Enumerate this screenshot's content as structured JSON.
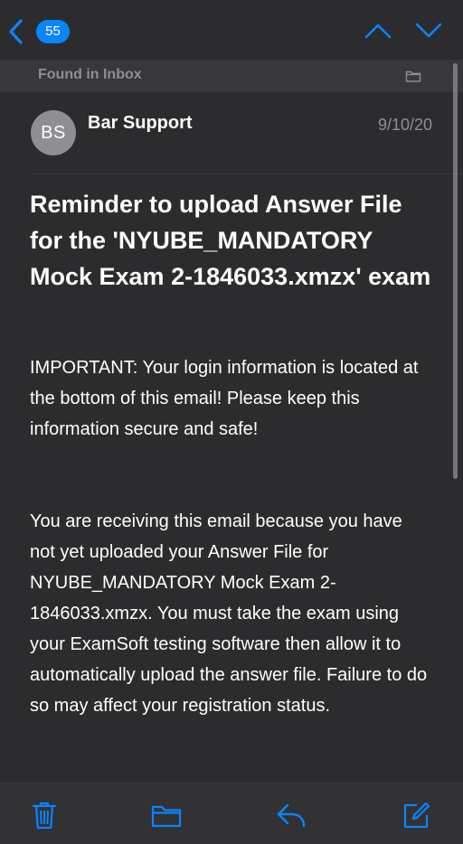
{
  "nav": {
    "back_count": "55"
  },
  "banner": {
    "found_text": "Found in Inbox"
  },
  "message": {
    "avatar_initials": "BS",
    "sender": "Bar Support",
    "date": "9/10/20",
    "subject": "Reminder to upload Answer File for the 'NYUBE_MANDATORY Mock Exam 2-1846033.xmzx' exam",
    "body": [
      "IMPORTANT: Your login information is located at the bottom of this email! Please keep this information secure and safe!",
      "You are receiving this email because you have not yet uploaded your Answer File for NYUBE_MANDATORY Mock Exam 2-1846033.xmzx. You must take the exam using your ExamSoft testing software then allow it to automatically upload the answer file. Failure to do so may affect your registration status."
    ]
  },
  "icons": {
    "back": "chevron-left-icon",
    "up": "chevron-up-icon",
    "down": "chevron-down-icon",
    "folder": "folder-icon",
    "trash": "trash-icon",
    "reply": "reply-icon",
    "compose": "compose-icon"
  },
  "colors": {
    "accent": "#0a84ff",
    "background": "#2c2c2e",
    "banner": "#38383a",
    "secondary_text": "#8e8e93"
  }
}
